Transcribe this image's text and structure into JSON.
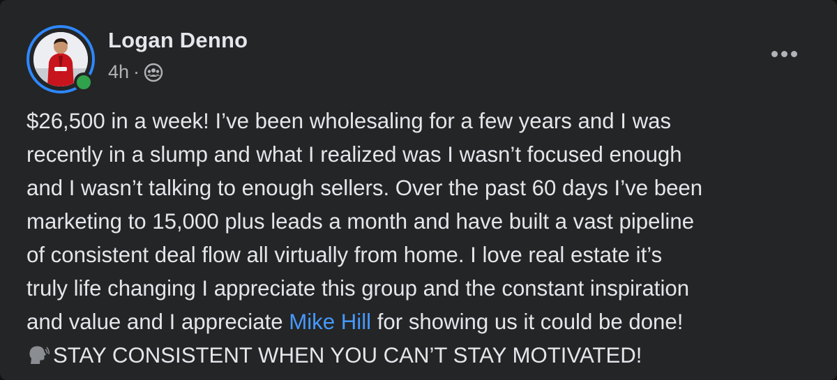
{
  "post": {
    "author": "Logan Denno",
    "timestamp": "4h",
    "separator": "·",
    "audience_icon": "group-audience-icon",
    "more_icon": "more-options-icon",
    "avatar_ring_color": "#2d88ff",
    "online_status_color": "#31a24c",
    "mention_color": "#4599ff",
    "body": {
      "line1": "$26,500 in a week! I’ve been wholesaling for a few years and I was",
      "line2": "recently in a slump and what I realized was I wasn’t focused enough",
      "line3": "and I wasn’t talking to enough sellers. Over the past 60 days I’ve been",
      "line4": "marketing to 15,000 plus leads a month and have built a vast pipeline",
      "line5": "of consistent deal flow all virtually from home. I love real estate it’s",
      "line6": "truly life changing I appreciate this group and the constant inspiration",
      "line7_before": "and value and I appreciate ",
      "line7_mention": "Mike Hill",
      "line7_after": " for showing us it could be done!",
      "line8_emoji": "speaking-head-emoji",
      "line8": "STAY CONSISTENT WHEN YOU CAN’T STAY MOTIVATED!"
    }
  }
}
